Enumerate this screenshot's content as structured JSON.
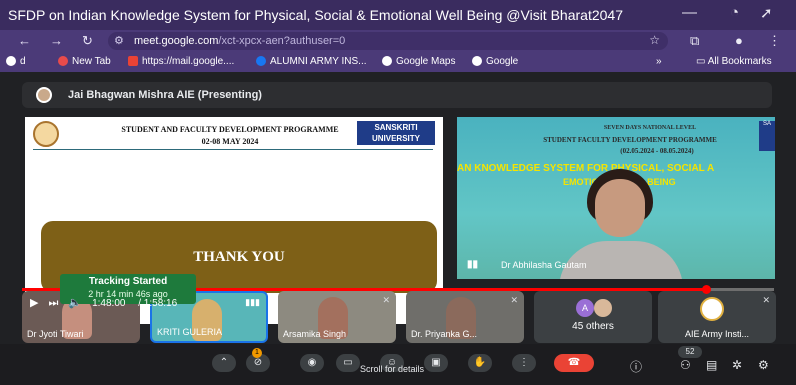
{
  "browser": {
    "title": "SFDP on Indian Knowledge System for Physical, Social & Emotional Well Being @Visit Bharat2047",
    "url_host": "meet.google.com",
    "url_path": "/xct-xpcx-aen?authuser=0",
    "icons": {
      "back": "arrow-left-icon",
      "forward": "arrow-right-icon",
      "reload": "reload-icon",
      "minimize": "minimize-icon",
      "star": "star-icon"
    }
  },
  "bookmarks": {
    "items": [
      "d",
      "New Tab",
      "https://mail.google....",
      "ALUMNI ARMY INS...",
      "Google Maps",
      "Google"
    ],
    "overflow": "»",
    "all": "All Bookmarks"
  },
  "meet": {
    "presenting_label": "Jai Bhagwan Mishra AIE (Presenting)",
    "slide": {
      "program": "STUDENT AND FACULTY DEVELOPMENT PROGRAMME",
      "dates": "02-08 MAY 2024",
      "logo_text": "SANSKRITI UNIVERSITY",
      "thank_you": "THANK YOU"
    },
    "presenter": {
      "banner_line1": "SEVEN DAYS NATIONAL LEVEL",
      "banner_line2": "STUDENT FACULTY DEVELOPMENT PROGRAMME",
      "banner_line3": "(02.05.2024 - 08.05.2024)",
      "yellow_line1": "AN KNOWLEDGE SYSTEM FOR PHYSICAL, SOCIAL A",
      "yellow_line2": "EMOTIONAL WELL BEING",
      "logo_text": "SA",
      "name": "Dr Abhilasha Gautam"
    },
    "tiles": [
      {
        "name": "Dr Jyoti Tiwari"
      },
      {
        "name": "KRITI GULERIA"
      },
      {
        "name": "Arsamika Singh"
      },
      {
        "name": "Dr. Priyanka G..."
      },
      {
        "name": "45 others",
        "avatar_letter": "A"
      },
      {
        "name": "AIE Army Insti..."
      }
    ],
    "controls": {
      "scroll_hint": "Scroll for details",
      "participant_count": "52",
      "notification_count": "1"
    }
  },
  "overlay": {
    "tracking_title": "Tracking Started",
    "tracking_sub": "2 hr 14 min 46s ago",
    "time_current": "1:48:00",
    "time_total": "1:58:16",
    "progress_fraction": 0.91
  },
  "colors": {
    "browser_title_bar": "#3a2c5f",
    "browser_toolbar": "#4b3a78",
    "meet_bg": "#202124",
    "slide_button": "#7e6017",
    "hangup": "#ea4335",
    "progress": "#ff0000",
    "tracking": "#1e7a3c"
  }
}
